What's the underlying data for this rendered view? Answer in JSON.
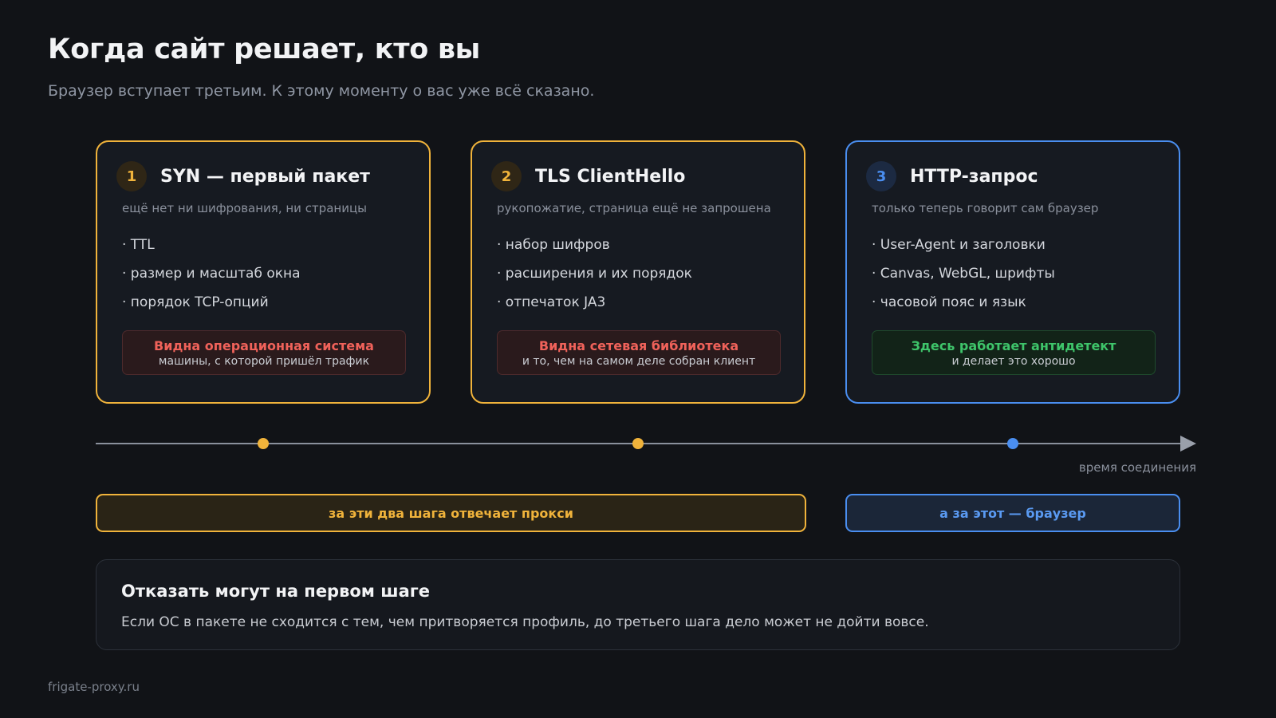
{
  "header": {
    "title": "Когда сайт решает, кто вы",
    "subtitle": "Браузер вступает третьим. К этому моменту о вас уже всё сказано."
  },
  "steps": [
    {
      "number": "1",
      "title": "SYN — первый пакет",
      "desc": "ещё нет ни шифрования, ни страницы",
      "bullets": [
        "· TTL",
        "· размер и масштаб окна",
        "· порядок TCP-опций"
      ],
      "verdict_main": "Видна операционная система",
      "verdict_sub": "машины, с которой пришёл трафик",
      "accent": "#f0b33b"
    },
    {
      "number": "2",
      "title": "TLS ClientHello",
      "desc": "рукопожатие, страница ещё не запрошена",
      "bullets": [
        "· набор шифров",
        "· расширения и их порядок",
        "· отпечаток JA3"
      ],
      "verdict_main": "Видна сетевая библиотека",
      "verdict_sub": "и то, чем на самом деле собран клиент",
      "accent": "#f0b33b"
    },
    {
      "number": "3",
      "title": "HTTP-запрос",
      "desc": "только теперь говорит сам браузер",
      "bullets": [
        "· User-Agent и заголовки",
        "· Canvas, WebGL, шрифты",
        "· часовой пояс и язык"
      ],
      "verdict_main": "Здесь работает антидетект",
      "verdict_sub": "и делает это хорошо",
      "accent": "#4a8ef0"
    }
  ],
  "timeline": {
    "label": "время соединения"
  },
  "responsibility": {
    "proxy": "за эти два шага отвечает прокси",
    "browser": "а за этот — браузер"
  },
  "note": {
    "title": "Отказать могут на первом шаге",
    "text": "Если ОС в пакете не сходится с тем, чем притворяется профиль, до третьего шага дело может не дойти вовсе."
  },
  "footer": "frigate-proxy.ru"
}
